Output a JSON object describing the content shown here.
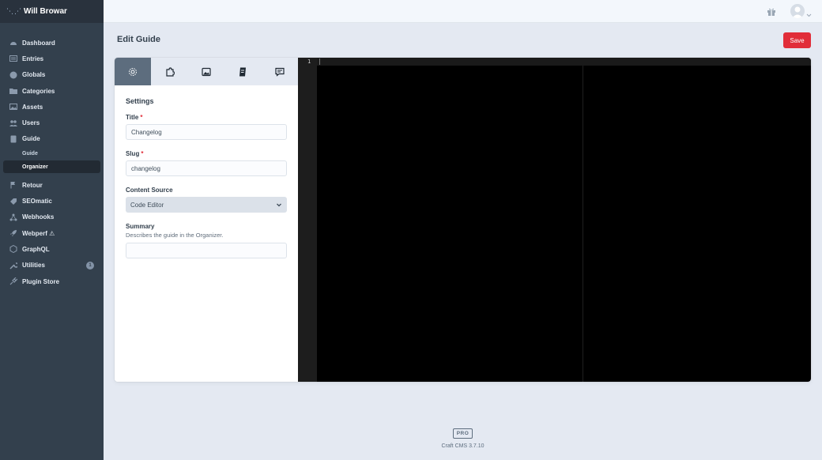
{
  "sidebar": {
    "site_name": "Will Browar",
    "items": [
      {
        "label": "Dashboard",
        "icon": "gauge-icon"
      },
      {
        "label": "Entries",
        "icon": "newspaper-icon"
      },
      {
        "label": "Globals",
        "icon": "globe-icon"
      },
      {
        "label": "Categories",
        "icon": "folder-icon"
      },
      {
        "label": "Assets",
        "icon": "image-icon"
      },
      {
        "label": "Users",
        "icon": "users-icon"
      },
      {
        "label": "Guide",
        "icon": "book-icon"
      }
    ],
    "guide_subitems": [
      {
        "label": "Guide",
        "active": false
      },
      {
        "label": "Organizer",
        "active": true
      }
    ],
    "items_after": [
      {
        "label": "Retour",
        "icon": "flag-icon"
      },
      {
        "label": "SEOmatic",
        "icon": "tag-icon"
      },
      {
        "label": "Webhooks",
        "icon": "webhook-icon"
      },
      {
        "label": "Webperf ⚠",
        "icon": "rocket-icon"
      },
      {
        "label": "GraphQL",
        "icon": "graphql-icon"
      },
      {
        "label": "Utilities",
        "icon": "wrench-icon",
        "badge": "1"
      },
      {
        "label": "Plugin Store",
        "icon": "plug-icon"
      }
    ]
  },
  "header": {
    "page_title": "Edit Guide",
    "save_label": "Save"
  },
  "panel": {
    "tabs": [
      "settings-icon",
      "puzzle-icon",
      "image-icon",
      "document-icon",
      "comment-icon"
    ],
    "section_title": "Settings",
    "title_label": "Title",
    "title_value": "Changelog",
    "slug_label": "Slug",
    "slug_value": "changelog",
    "content_source_label": "Content Source",
    "content_source_value": "Code Editor",
    "summary_label": "Summary",
    "summary_instructions": "Describes the guide in the Organizer.",
    "summary_value": "",
    "required_mark": "*"
  },
  "editor": {
    "line_number": "1"
  },
  "footer": {
    "edition": "PRO",
    "version": "Craft CMS 3.7.10"
  },
  "colors": {
    "sidebar": "#33404d",
    "save": "#e12d39",
    "editor_bg": "#000000"
  }
}
